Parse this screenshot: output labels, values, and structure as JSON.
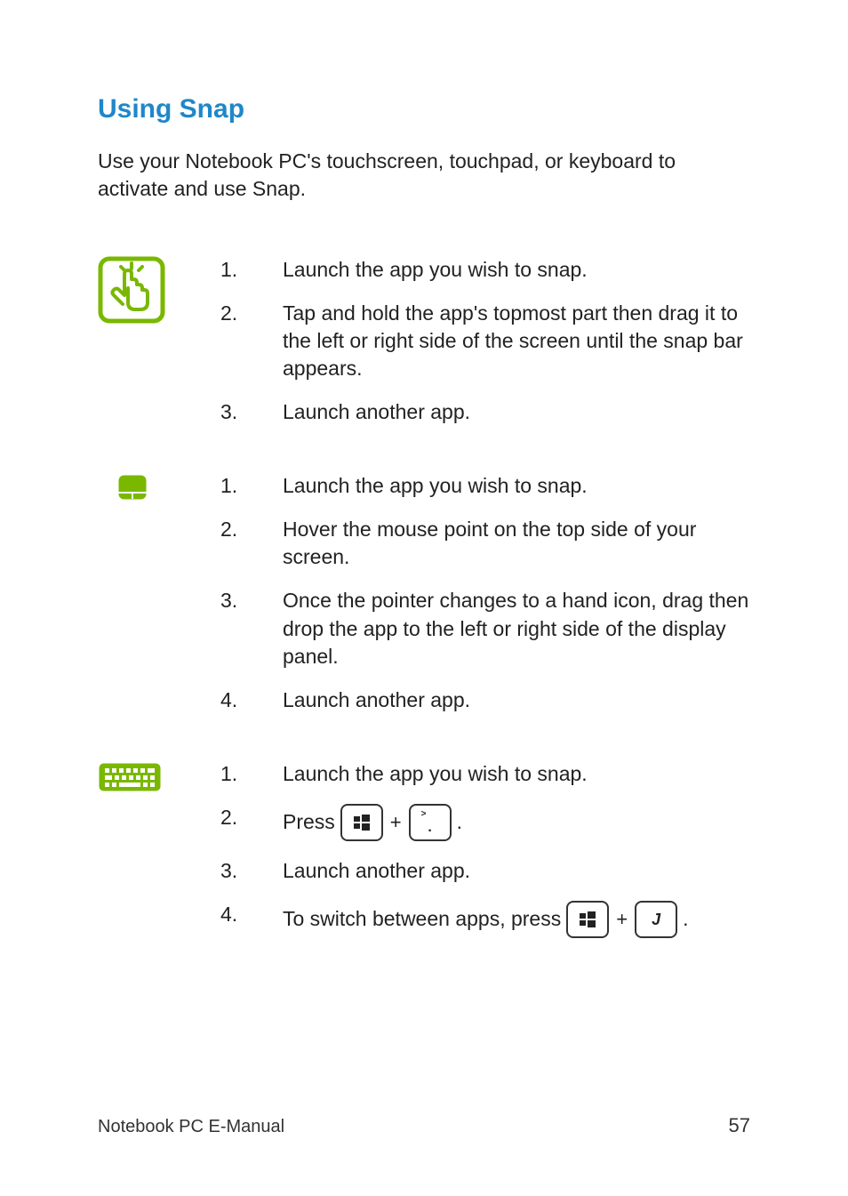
{
  "heading": "Using Snap",
  "intro": "Use your Notebook PC's touchscreen, touchpad, or keyboard to activate and use Snap.",
  "touch": {
    "items": [
      "Launch the app you wish to snap.",
      "Tap and hold the app's topmost part then drag it to the left or right side of the screen until the snap bar appears.",
      "Launch another app."
    ]
  },
  "touchpad": {
    "items": [
      "Launch the app you wish to snap.",
      "Hover the mouse point on the top side of your screen.",
      "Once the pointer changes to a hand icon, drag then drop the app to the left or right side of the display panel.",
      "Launch another app."
    ]
  },
  "keyboard": {
    "item1": "Launch the app you wish to snap.",
    "item2_prefix": "Press",
    "item2_plus": "+",
    "item2_suffix": ".",
    "item3": "Launch another app.",
    "item4_prefix": "To switch between apps, press",
    "item4_plus": "+",
    "item4_key2": "J",
    "item4_suffix": ".",
    "period_key_sup": ">",
    "period_key_main": "."
  },
  "numbers": {
    "n1": "1.",
    "n2": "2.",
    "n3": "3.",
    "n4": "4."
  },
  "footer": {
    "title": "Notebook PC E-Manual",
    "page": "57"
  }
}
